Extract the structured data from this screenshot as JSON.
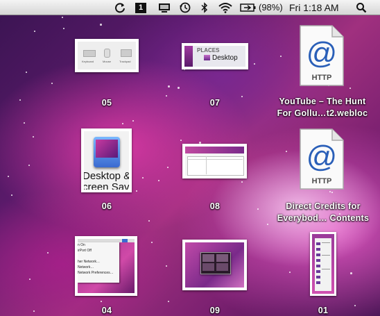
{
  "menubar": {
    "sync_icon": "sync-icon",
    "one_icon_label": "1",
    "battery_percent": "(98%)",
    "clock": "Fri 1:18 AM"
  },
  "desktop_items": {
    "item_05": {
      "label": "05"
    },
    "item_07": {
      "label": "07",
      "places_header": "PLACES",
      "places_item": "Desktop"
    },
    "item_youtube": {
      "line1": "YouTube – The Hunt",
      "line2": "For Gollu…t2.webloc",
      "doc_badge": "HTTP"
    },
    "item_06": {
      "label": "06",
      "thumb_text1": "Desktop &",
      "thumb_text2": "creen Sav"
    },
    "item_08": {
      "label": "08"
    },
    "item_direct": {
      "line1": "Direct Credits for",
      "line2": "Everybod… Contents",
      "doc_badge": "HTTP"
    },
    "item_04": {
      "label": "04",
      "menu_lines": [
        "n On",
        "irPort Off",
        "",
        "her Network…",
        "Network…",
        "Network Preferences…"
      ]
    },
    "item_09": {
      "label": "09"
    },
    "item_01": {
      "label": "01"
    }
  },
  "thumb_05": {
    "labels": [
      "Keyboard",
      "Mouse",
      "Trackpad"
    ]
  },
  "colors": {
    "menubar_top": "#f4f4f4",
    "menubar_bottom": "#d6d6d6",
    "http_blue": "#2a5fb8"
  }
}
